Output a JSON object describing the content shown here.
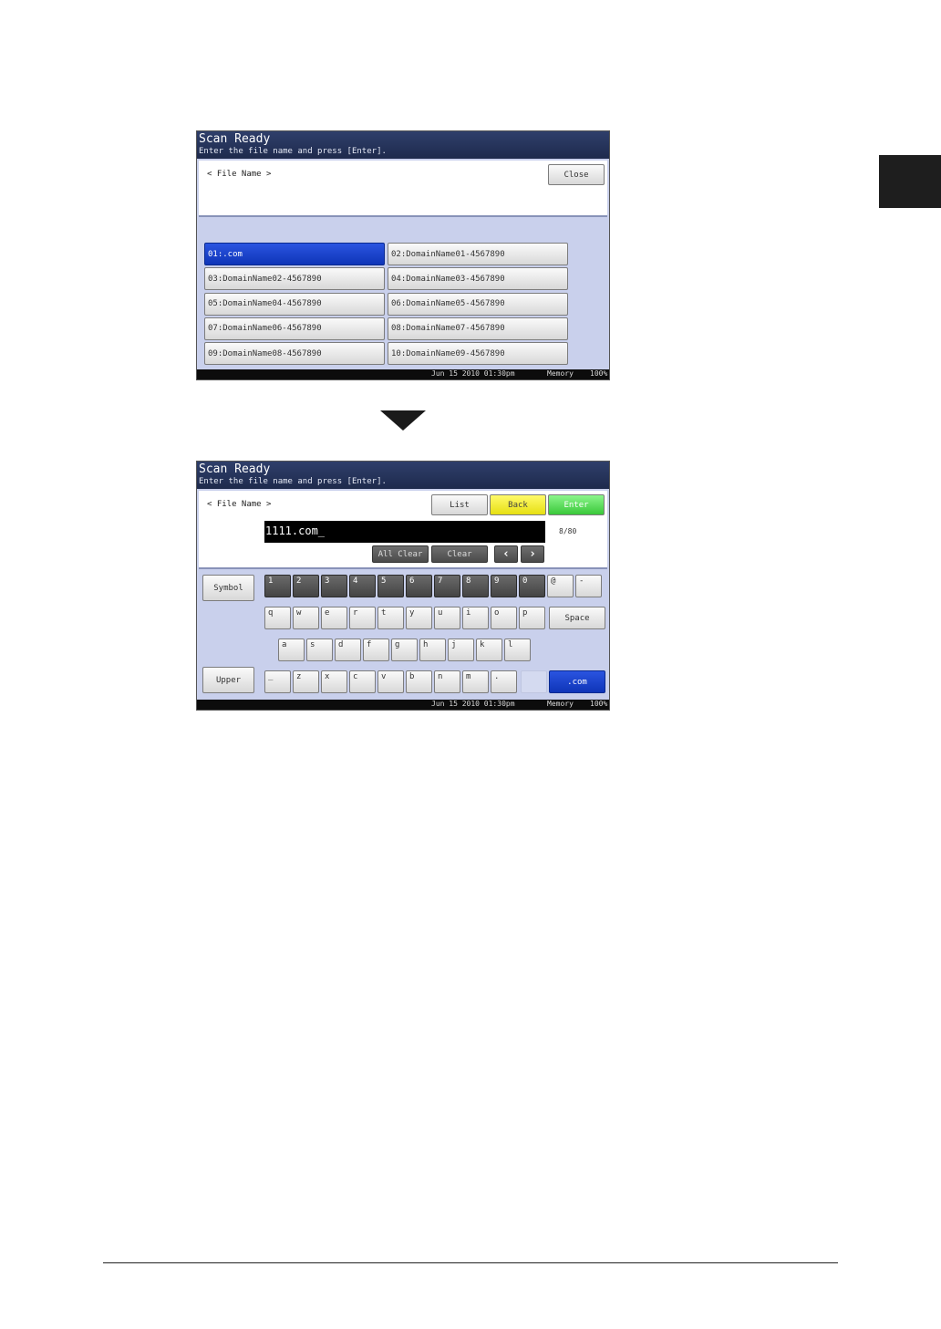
{
  "screen1": {
    "title": "Scan Ready",
    "subtitle": "Enter the file name and press [Enter].",
    "file_name_label": "< File Name >",
    "close_label": "Close",
    "entries": [
      "01:.com",
      "02:DomainName01-4567890",
      "03:DomainName02-4567890",
      "04:DomainName03-4567890",
      "05:DomainName04-4567890",
      "06:DomainName05-4567890",
      "07:DomainName06-4567890",
      "08:DomainName07-4567890",
      "09:DomainName08-4567890",
      "10:DomainName09-4567890"
    ],
    "selected_entry": "01:.com",
    "status": {
      "datetime": "Jun 15 2010 01:30pm",
      "memory_label": "Memory",
      "memory_value": "100%"
    }
  },
  "screen2": {
    "title": "Scan Ready",
    "subtitle": "Enter the file name and press [Enter].",
    "file_name_label": "< File Name >",
    "list_label": "List",
    "back_label": "Back",
    "enter_label": "Enter",
    "input_value": "1111.com_",
    "counter": "8/80",
    "all_clear_label": "All Clear",
    "clear_label": "Clear",
    "symbol_label": "Symbol",
    "upper_label": "Upper",
    "space_label": "Space",
    "dotcom_label": ".com",
    "row_numbers": [
      "1",
      "2",
      "3",
      "4",
      "5",
      "6",
      "7",
      "8",
      "9",
      "0",
      "@",
      "-"
    ],
    "row_q": [
      "q",
      "w",
      "e",
      "r",
      "t",
      "y",
      "u",
      "i",
      "o",
      "p"
    ],
    "row_a": [
      "a",
      "s",
      "d",
      "f",
      "g",
      "h",
      "j",
      "k",
      "l"
    ],
    "row_z": [
      "_",
      "z",
      "x",
      "c",
      "v",
      "b",
      "n",
      "m",
      "."
    ],
    "status": {
      "datetime": "Jun 15 2010 01:30pm",
      "memory_label": "Memory",
      "memory_value": "100%"
    }
  },
  "colors": {
    "selected": "#1437c8",
    "back": "#f0eb2a",
    "enter": "#4cd64c",
    "title_bar": "#26355c"
  }
}
